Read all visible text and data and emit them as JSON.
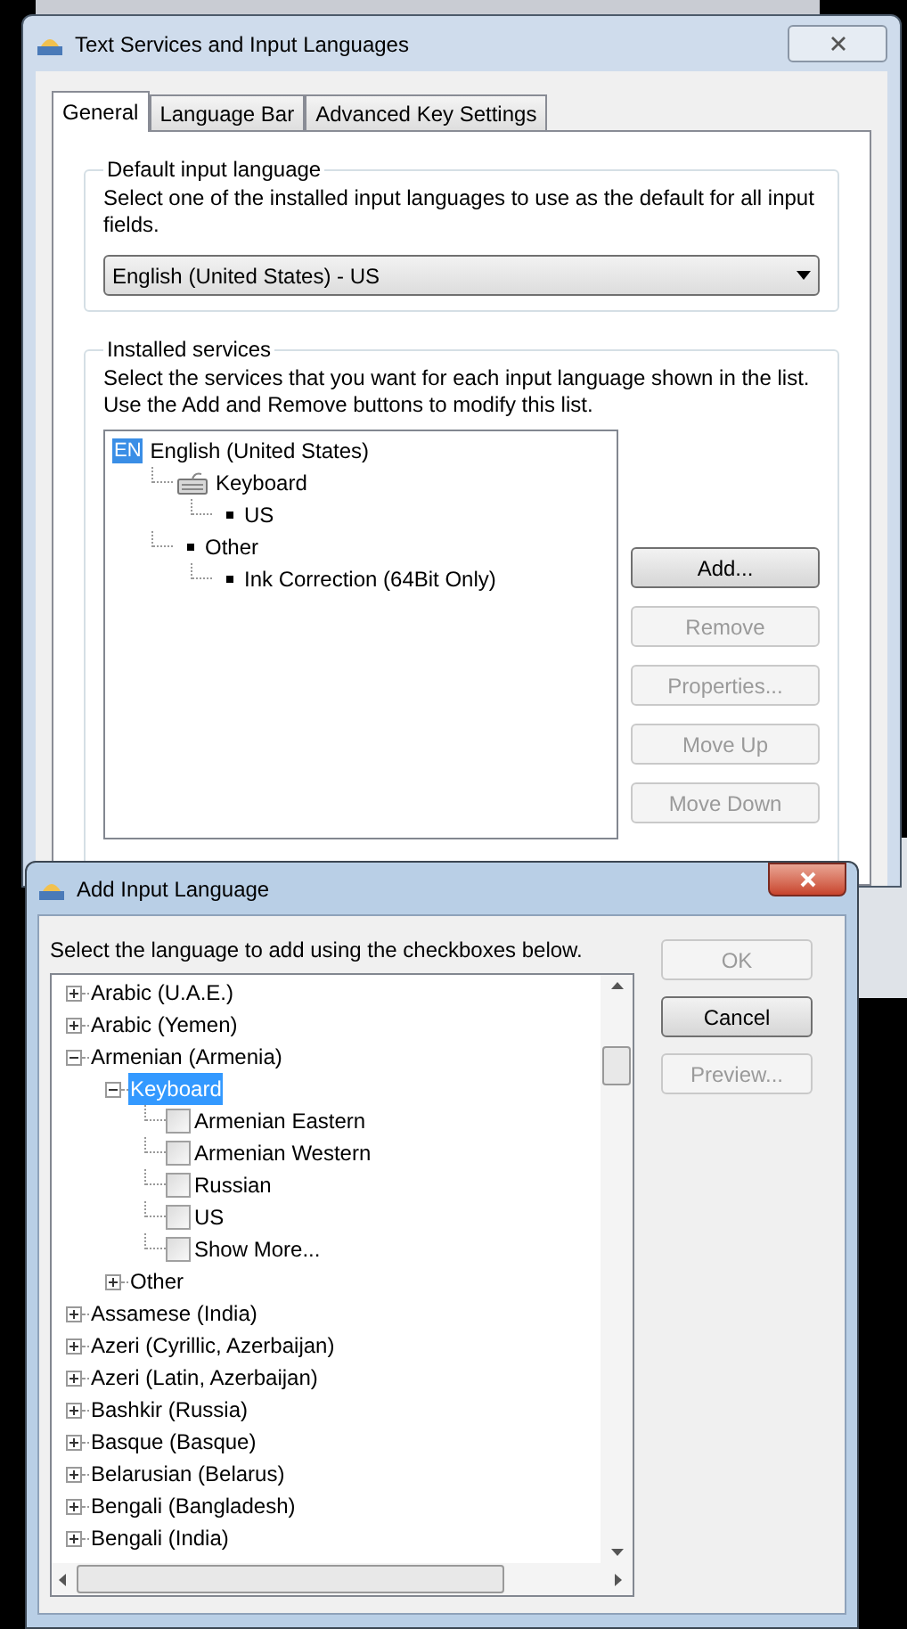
{
  "main_window": {
    "title": "Text Services and Input Languages",
    "tabs": [
      {
        "label": "General",
        "selected": true
      },
      {
        "label": "Language Bar",
        "selected": false
      },
      {
        "label": "Advanced Key Settings",
        "selected": false
      }
    ],
    "default_language": {
      "heading": "Default input language",
      "description": "Select one of the installed input languages to use as the default for all input fields.",
      "value": "English (United States) - US"
    },
    "installed_services": {
      "heading": "Installed services",
      "description": "Select the services that you want for each input language shown in the list. Use the Add and Remove buttons to modify this list.",
      "tree": [
        {
          "kind": "language",
          "badge": "EN",
          "label": "English (United States)",
          "children": [
            {
              "kind": "keyboard",
              "label": "Keyboard",
              "children": [
                {
                  "kind": "bullet",
                  "label": "US"
                }
              ]
            },
            {
              "kind": "bullet",
              "label": "Other",
              "children": [
                {
                  "kind": "bullet",
                  "label": "Ink Correction (64Bit Only)"
                }
              ]
            }
          ]
        }
      ],
      "buttons": [
        {
          "label": "Add...",
          "disabled": false
        },
        {
          "label": "Remove",
          "disabled": true
        },
        {
          "label": "Properties...",
          "disabled": true
        },
        {
          "label": "Move Up",
          "disabled": true
        },
        {
          "label": "Move Down",
          "disabled": true
        }
      ]
    }
  },
  "add_dialog": {
    "title": "Add Input Language",
    "instruction": "Select the language to add using the checkboxes below.",
    "tree": [
      {
        "kind": "node",
        "label": "Arabic (U.A.E.)",
        "expanded": false,
        "selected": false
      },
      {
        "kind": "node",
        "label": "Arabic (Yemen)",
        "expanded": false,
        "selected": false
      },
      {
        "kind": "node",
        "label": "Armenian (Armenia)",
        "expanded": true,
        "selected": false,
        "children": [
          {
            "kind": "node",
            "label": "Keyboard",
            "expanded": true,
            "selected": true,
            "children": [
              {
                "kind": "checkbox",
                "label": "Armenian Eastern",
                "checked": false
              },
              {
                "kind": "checkbox",
                "label": "Armenian Western",
                "checked": false
              },
              {
                "kind": "checkbox",
                "label": "Russian",
                "checked": false
              },
              {
                "kind": "checkbox",
                "label": "US",
                "checked": false
              },
              {
                "kind": "checkbox",
                "label": "Show More...",
                "checked": false
              }
            ]
          },
          {
            "kind": "node",
            "label": "Other",
            "expanded": false,
            "selected": false
          }
        ]
      },
      {
        "kind": "node",
        "label": "Assamese (India)",
        "expanded": false,
        "selected": false
      },
      {
        "kind": "node",
        "label": "Azeri (Cyrillic, Azerbaijan)",
        "expanded": false,
        "selected": false
      },
      {
        "kind": "node",
        "label": "Azeri (Latin, Azerbaijan)",
        "expanded": false,
        "selected": false
      },
      {
        "kind": "node",
        "label": "Bashkir (Russia)",
        "expanded": false,
        "selected": false
      },
      {
        "kind": "node",
        "label": "Basque (Basque)",
        "expanded": false,
        "selected": false
      },
      {
        "kind": "node",
        "label": "Belarusian (Belarus)",
        "expanded": false,
        "selected": false
      },
      {
        "kind": "node",
        "label": "Bengali (Bangladesh)",
        "expanded": false,
        "selected": false
      },
      {
        "kind": "node",
        "label": "Bengali (India)",
        "expanded": false,
        "selected": false
      }
    ],
    "buttons": [
      {
        "label": "OK",
        "disabled": true
      },
      {
        "label": "Cancel",
        "disabled": false
      },
      {
        "label": "Preview...",
        "disabled": true
      }
    ]
  }
}
